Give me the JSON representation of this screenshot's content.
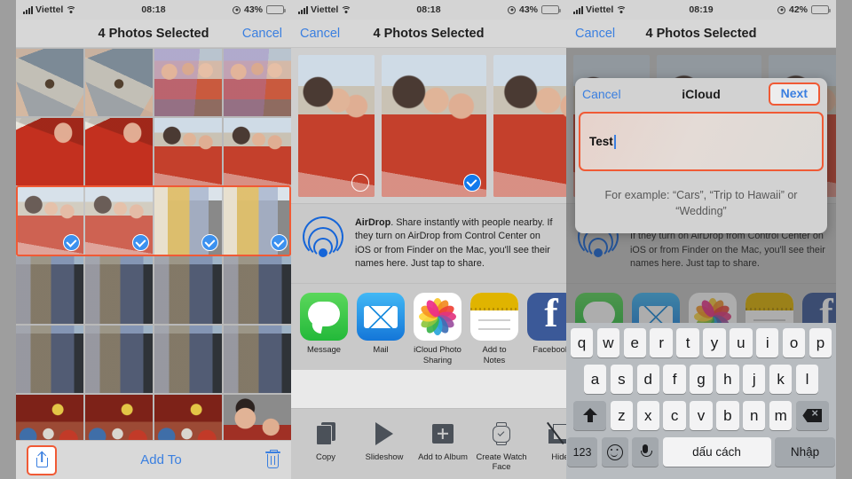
{
  "panels": [
    {
      "status": {
        "carrier": "Viettel",
        "time": "08:18",
        "battery": "43%",
        "battery_level": 43
      },
      "nav": {
        "title": "4 Photos Selected",
        "right_button": "Cancel"
      },
      "toolbar": {
        "share_icon": "share-icon",
        "add_to": "Add To",
        "trash_icon": "trash-icon"
      },
      "grid": {
        "selected_row_index": 2,
        "rows": [
          [
            "hands",
            "hands",
            "group1",
            "group1"
          ],
          [
            "red",
            "red",
            "selfie",
            "selfie"
          ],
          [
            "selfie",
            "selfie",
            "wall",
            "wall"
          ],
          [
            "dark",
            "dark",
            "dark",
            "dark"
          ],
          [
            "dark",
            "dark",
            "dark",
            "dark"
          ],
          [
            "party",
            "party",
            "party",
            "couple"
          ]
        ],
        "selected_cells": [
          [
            2,
            0
          ],
          [
            2,
            1
          ],
          [
            2,
            2
          ],
          [
            2,
            3
          ]
        ]
      }
    },
    {
      "status": {
        "carrier": "Viettel",
        "time": "08:18",
        "battery": "43%",
        "battery_level": 43
      },
      "nav": {
        "title": "4 Photos Selected",
        "left_button": "Cancel"
      },
      "previews": [
        {
          "art": "selfie",
          "state": "unselected"
        },
        {
          "art": "selfie2",
          "state": "selected"
        },
        {
          "art": "selfie",
          "state": "selected"
        }
      ],
      "airdrop": {
        "title": "AirDrop",
        "body": ". Share instantly with people nearby. If they turn on AirDrop from Control Center on iOS or from Finder on the Mac, you'll see their names here. Just tap to share."
      },
      "apps": [
        {
          "label": "Message",
          "icon": "message-icon",
          "highlighted": false
        },
        {
          "label": "Mail",
          "icon": "mail-icon",
          "highlighted": false
        },
        {
          "label": "iCloud Photo Sharing",
          "icon": "photos-icon",
          "highlighted": true
        },
        {
          "label": "Add to Notes",
          "icon": "notes-icon",
          "highlighted": false
        },
        {
          "label": "Facebook",
          "icon": "facebook-icon",
          "highlighted": false
        }
      ],
      "actions": [
        {
          "label": "Copy",
          "icon": "copy-icon"
        },
        {
          "label": "Slideshow",
          "icon": "play-icon"
        },
        {
          "label": "Add to Album",
          "icon": "add-album-icon"
        },
        {
          "label": "Create Watch Face",
          "icon": "watch-icon"
        },
        {
          "label": "Hide",
          "icon": "hide-icon"
        }
      ]
    },
    {
      "status": {
        "carrier": "Viettel",
        "time": "08:19",
        "battery": "42%",
        "battery_level": 42
      },
      "nav": {
        "title": "4 Photos Selected",
        "left_button": "Cancel"
      },
      "dialog": {
        "title": "iCloud",
        "cancel": "Cancel",
        "next": "Next",
        "field_value": "Test",
        "hint": "For example: “Cars”, “Trip to Hawaii” or “Wedding”"
      },
      "keyboard": {
        "row1": [
          "q",
          "w",
          "e",
          "r",
          "t",
          "y",
          "u",
          "i",
          "o",
          "p"
        ],
        "row2": [
          "a",
          "s",
          "d",
          "f",
          "g",
          "h",
          "j",
          "k",
          "l"
        ],
        "row3": [
          "z",
          "x",
          "c",
          "v",
          "b",
          "n",
          "m"
        ],
        "shift_icon": "shift-icon",
        "delete_icon": "delete-icon",
        "numbers_key": "123",
        "emoji_icon": "emoji-icon",
        "mic_icon": "microphone-icon",
        "space_key": "dấu cách",
        "return_key": "Nhập"
      }
    }
  ],
  "colors": {
    "accent_blue": "#3a7fe0",
    "highlight_orange": "#f05a35",
    "check_blue": "#1279ec",
    "battery_yellow": "#f2ce2b"
  }
}
